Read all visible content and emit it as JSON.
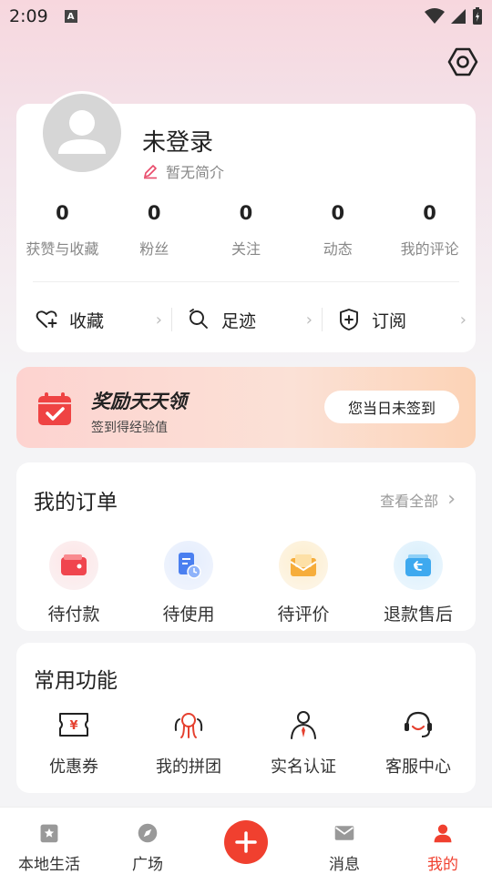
{
  "status": {
    "time": "2:09",
    "a_icon": "A"
  },
  "profile": {
    "name": "未登录",
    "intro": "暂无简介",
    "stats": [
      {
        "value": "0",
        "label": "获赞与收藏"
      },
      {
        "value": "0",
        "label": "粉丝"
      },
      {
        "value": "0",
        "label": "关注"
      },
      {
        "value": "0",
        "label": "动态"
      },
      {
        "value": "0",
        "label": "我的评论"
      }
    ],
    "quick": [
      {
        "label": "收藏",
        "icon": "heart-plus-icon"
      },
      {
        "label": "足迹",
        "icon": "footprint-icon"
      },
      {
        "label": "订阅",
        "icon": "subscribe-icon"
      }
    ]
  },
  "reward": {
    "title": "奖励天天领",
    "subtitle": "签到得经验值",
    "button": "您当日未签到"
  },
  "orders": {
    "title": "我的订单",
    "view_all": "查看全部",
    "items": [
      {
        "label": "待付款",
        "icon": "wallet-icon",
        "color": "#f0454e"
      },
      {
        "label": "待使用",
        "icon": "ticket-clock-icon",
        "color": "#4a7ff0"
      },
      {
        "label": "待评价",
        "icon": "mail-icon",
        "color": "#f6ad3b"
      },
      {
        "label": "退款售后",
        "icon": "refund-icon",
        "color": "#3ea9ef"
      }
    ]
  },
  "functions": {
    "title": "常用功能",
    "items": [
      {
        "label": "优惠券",
        "icon": "coupon-icon"
      },
      {
        "label": "我的拼团",
        "icon": "group-buy-icon"
      },
      {
        "label": "实名认证",
        "icon": "verify-identity-icon"
      },
      {
        "label": "客服中心",
        "icon": "customer-service-icon"
      }
    ]
  },
  "tabbar": {
    "items": [
      {
        "label": "本地生活",
        "icon": "local-life-icon"
      },
      {
        "label": "广场",
        "icon": "compass-icon"
      },
      {
        "label": "",
        "icon": "add-icon"
      },
      {
        "label": "消息",
        "icon": "message-icon"
      },
      {
        "label": "我的",
        "icon": "profile-icon"
      }
    ],
    "active_color": "#f0402f"
  }
}
